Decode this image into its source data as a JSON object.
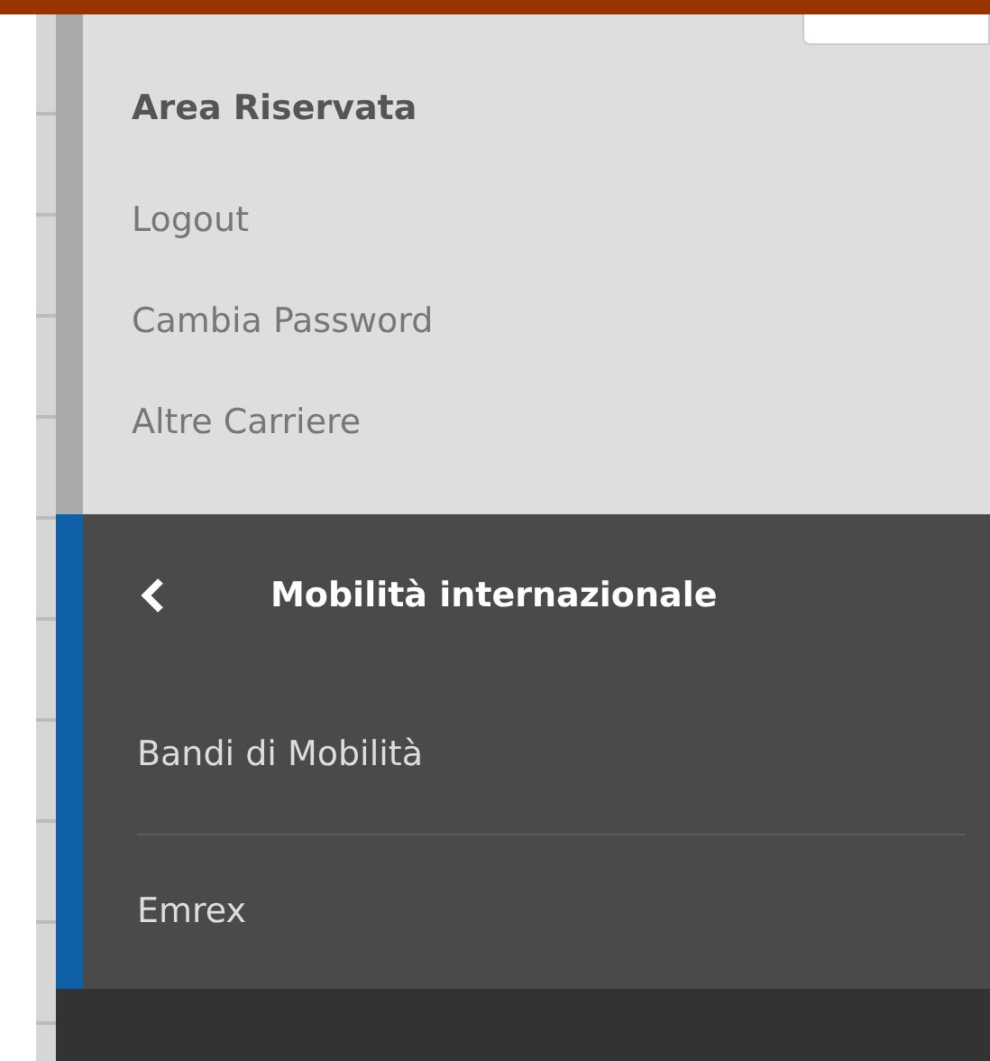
{
  "reserved_area": {
    "title": "Area Riservata",
    "links": [
      "Logout",
      "Cambia Password",
      "Altre Carriere"
    ]
  },
  "submenu": {
    "title": "Mobilità internazionale",
    "items": [
      "Bandi di Mobilità",
      "Emrex"
    ]
  }
}
